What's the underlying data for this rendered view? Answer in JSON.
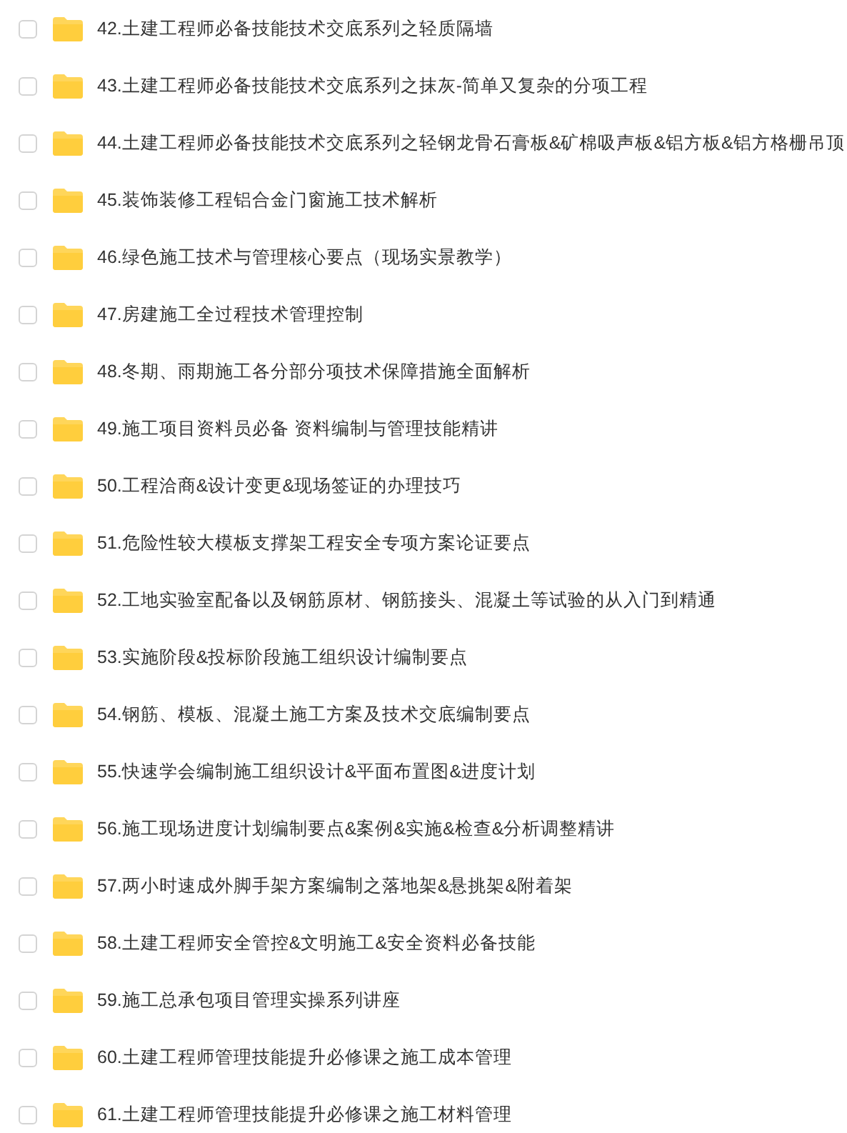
{
  "items": [
    {
      "name": "42.土建工程师必备技能技术交底系列之轻质隔墙",
      "checked": false
    },
    {
      "name": "43.土建工程师必备技能技术交底系列之抹灰-简单又复杂的分项工程",
      "checked": false
    },
    {
      "name": "44.土建工程师必备技能技术交底系列之轻钢龙骨石膏板&矿棉吸声板&铝方板&铝方格栅吊顶",
      "checked": false
    },
    {
      "name": "45.装饰装修工程铝合金门窗施工技术解析",
      "checked": false
    },
    {
      "name": "46.绿色施工技术与管理核心要点（现场实景教学）",
      "checked": false
    },
    {
      "name": "47.房建施工全过程技术管理控制",
      "checked": false
    },
    {
      "name": "48.冬期、雨期施工各分部分项技术保障措施全面解析",
      "checked": false
    },
    {
      "name": "49.施工项目资料员必备 资料编制与管理技能精讲",
      "checked": false
    },
    {
      "name": "50.工程洽商&设计变更&现场签证的办理技巧",
      "checked": false
    },
    {
      "name": "51.危险性较大模板支撑架工程安全专项方案论证要点",
      "checked": false
    },
    {
      "name": "52.工地实验室配备以及钢筋原材、钢筋接头、混凝土等试验的从入门到精通",
      "checked": false
    },
    {
      "name": "53.实施阶段&投标阶段施工组织设计编制要点",
      "checked": false
    },
    {
      "name": "54.钢筋、模板、混凝土施工方案及技术交底编制要点",
      "checked": false
    },
    {
      "name": "55.快速学会编制施工组织设计&平面布置图&进度计划",
      "checked": false
    },
    {
      "name": "56.施工现场进度计划编制要点&案例&实施&检查&分析调整精讲",
      "checked": false
    },
    {
      "name": "57.两小时速成外脚手架方案编制之落地架&悬挑架&附着架",
      "checked": false
    },
    {
      "name": "58.土建工程师安全管控&文明施工&安全资料必备技能",
      "checked": false
    },
    {
      "name": "59.施工总承包项目管理实操系列讲座",
      "checked": false
    },
    {
      "name": "60.土建工程师管理技能提升必修课之施工成本管理",
      "checked": false
    },
    {
      "name": "61.土建工程师管理技能提升必修课之施工材料管理",
      "checked": false
    }
  ]
}
